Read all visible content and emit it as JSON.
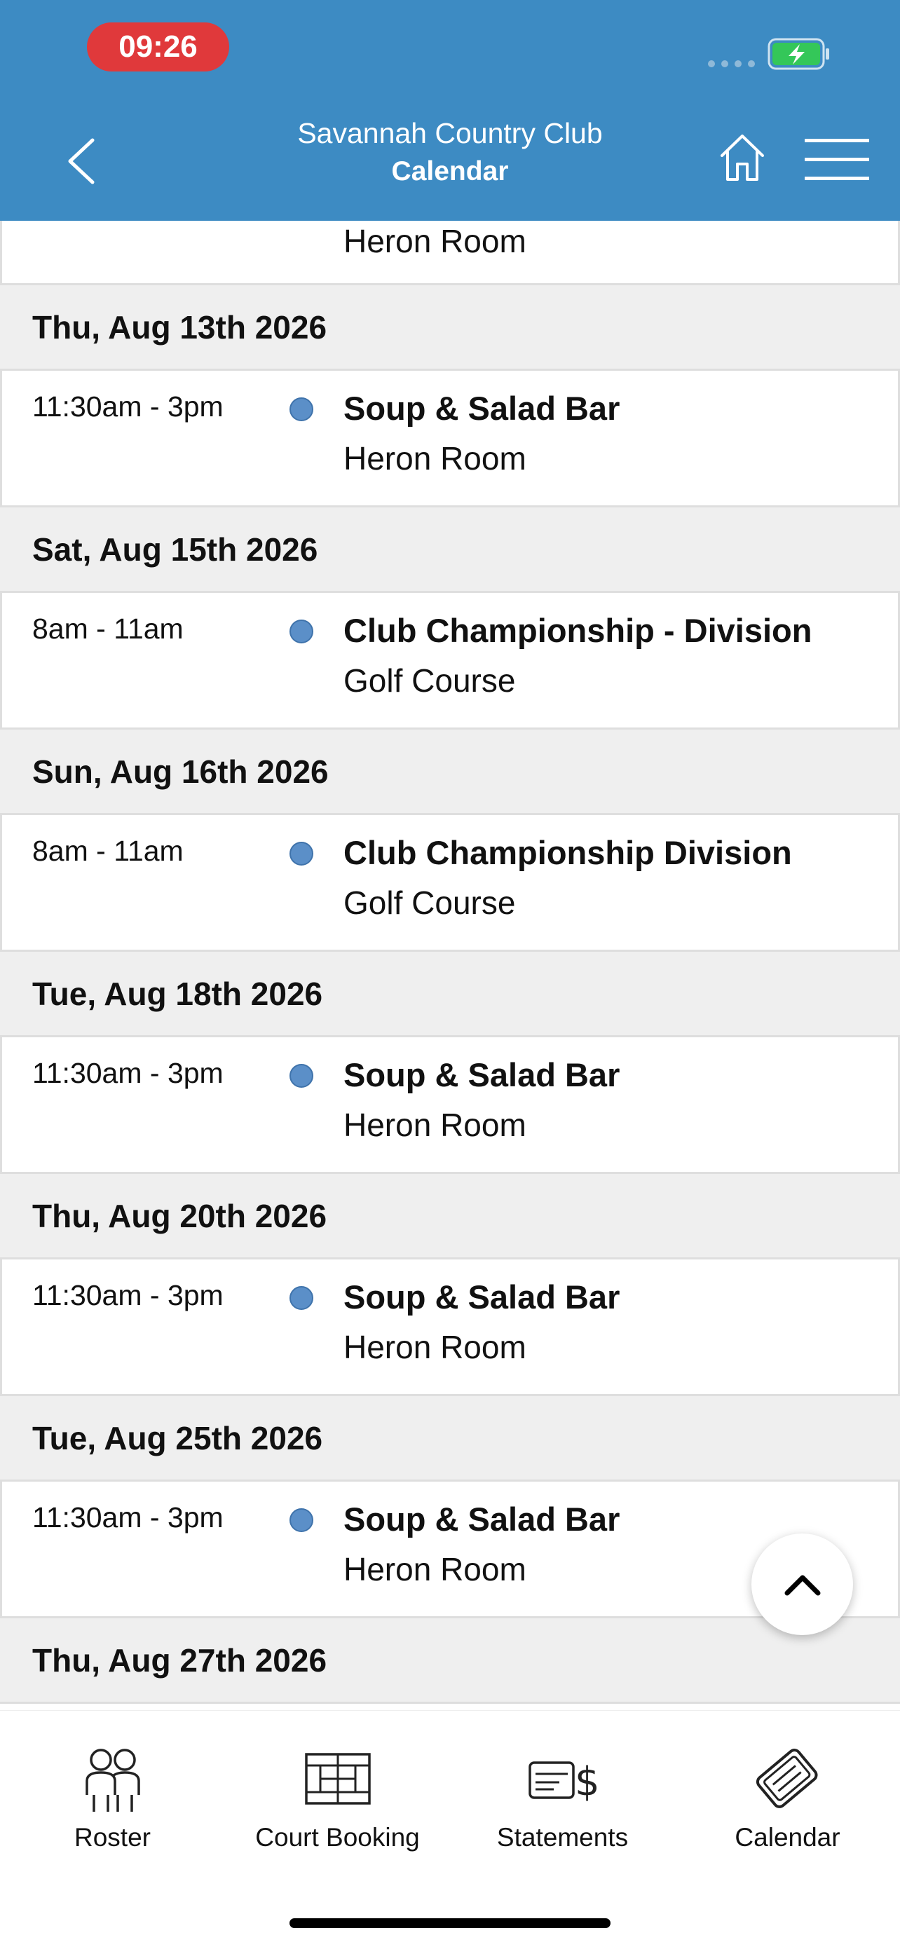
{
  "status": {
    "time": "09:26"
  },
  "header": {
    "club_name": "Savannah Country Club",
    "page_title": "Calendar"
  },
  "colors": {
    "header": "#3d8bc3",
    "time_pill": "#e0393b",
    "event_dot": "#5b8fc8",
    "date_row": "#efefef"
  },
  "partial_row": {
    "location": "Heron Room"
  },
  "days": [
    {
      "date": "Thu, Aug 13th 2026",
      "events": [
        {
          "time": "11:30am - 3pm",
          "title": "Soup & Salad Bar",
          "location": "Heron Room"
        }
      ]
    },
    {
      "date": "Sat, Aug 15th 2026",
      "events": [
        {
          "time": "8am - 11am",
          "title": "Club Championship - Division",
          "location": "Golf Course"
        }
      ]
    },
    {
      "date": "Sun, Aug 16th 2026",
      "events": [
        {
          "time": "8am - 11am",
          "title": "Club Championship Division",
          "location": "Golf Course"
        }
      ]
    },
    {
      "date": "Tue, Aug 18th 2026",
      "events": [
        {
          "time": "11:30am - 3pm",
          "title": "Soup & Salad Bar",
          "location": "Heron Room"
        }
      ]
    },
    {
      "date": "Thu, Aug 20th 2026",
      "events": [
        {
          "time": "11:30am - 3pm",
          "title": "Soup & Salad Bar",
          "location": "Heron Room"
        }
      ]
    },
    {
      "date": "Tue, Aug 25th 2026",
      "events": [
        {
          "time": "11:30am - 3pm",
          "title": "Soup & Salad Bar",
          "location": "Heron Room"
        }
      ]
    },
    {
      "date": "Thu, Aug 27th 2026",
      "events": []
    }
  ],
  "tabs": [
    {
      "label": "Roster",
      "icon": "roster-icon"
    },
    {
      "label": "Court Booking",
      "icon": "court-booking-icon"
    },
    {
      "label": "Statements",
      "icon": "statements-icon"
    },
    {
      "label": "Calendar",
      "icon": "calendar-icon"
    }
  ]
}
